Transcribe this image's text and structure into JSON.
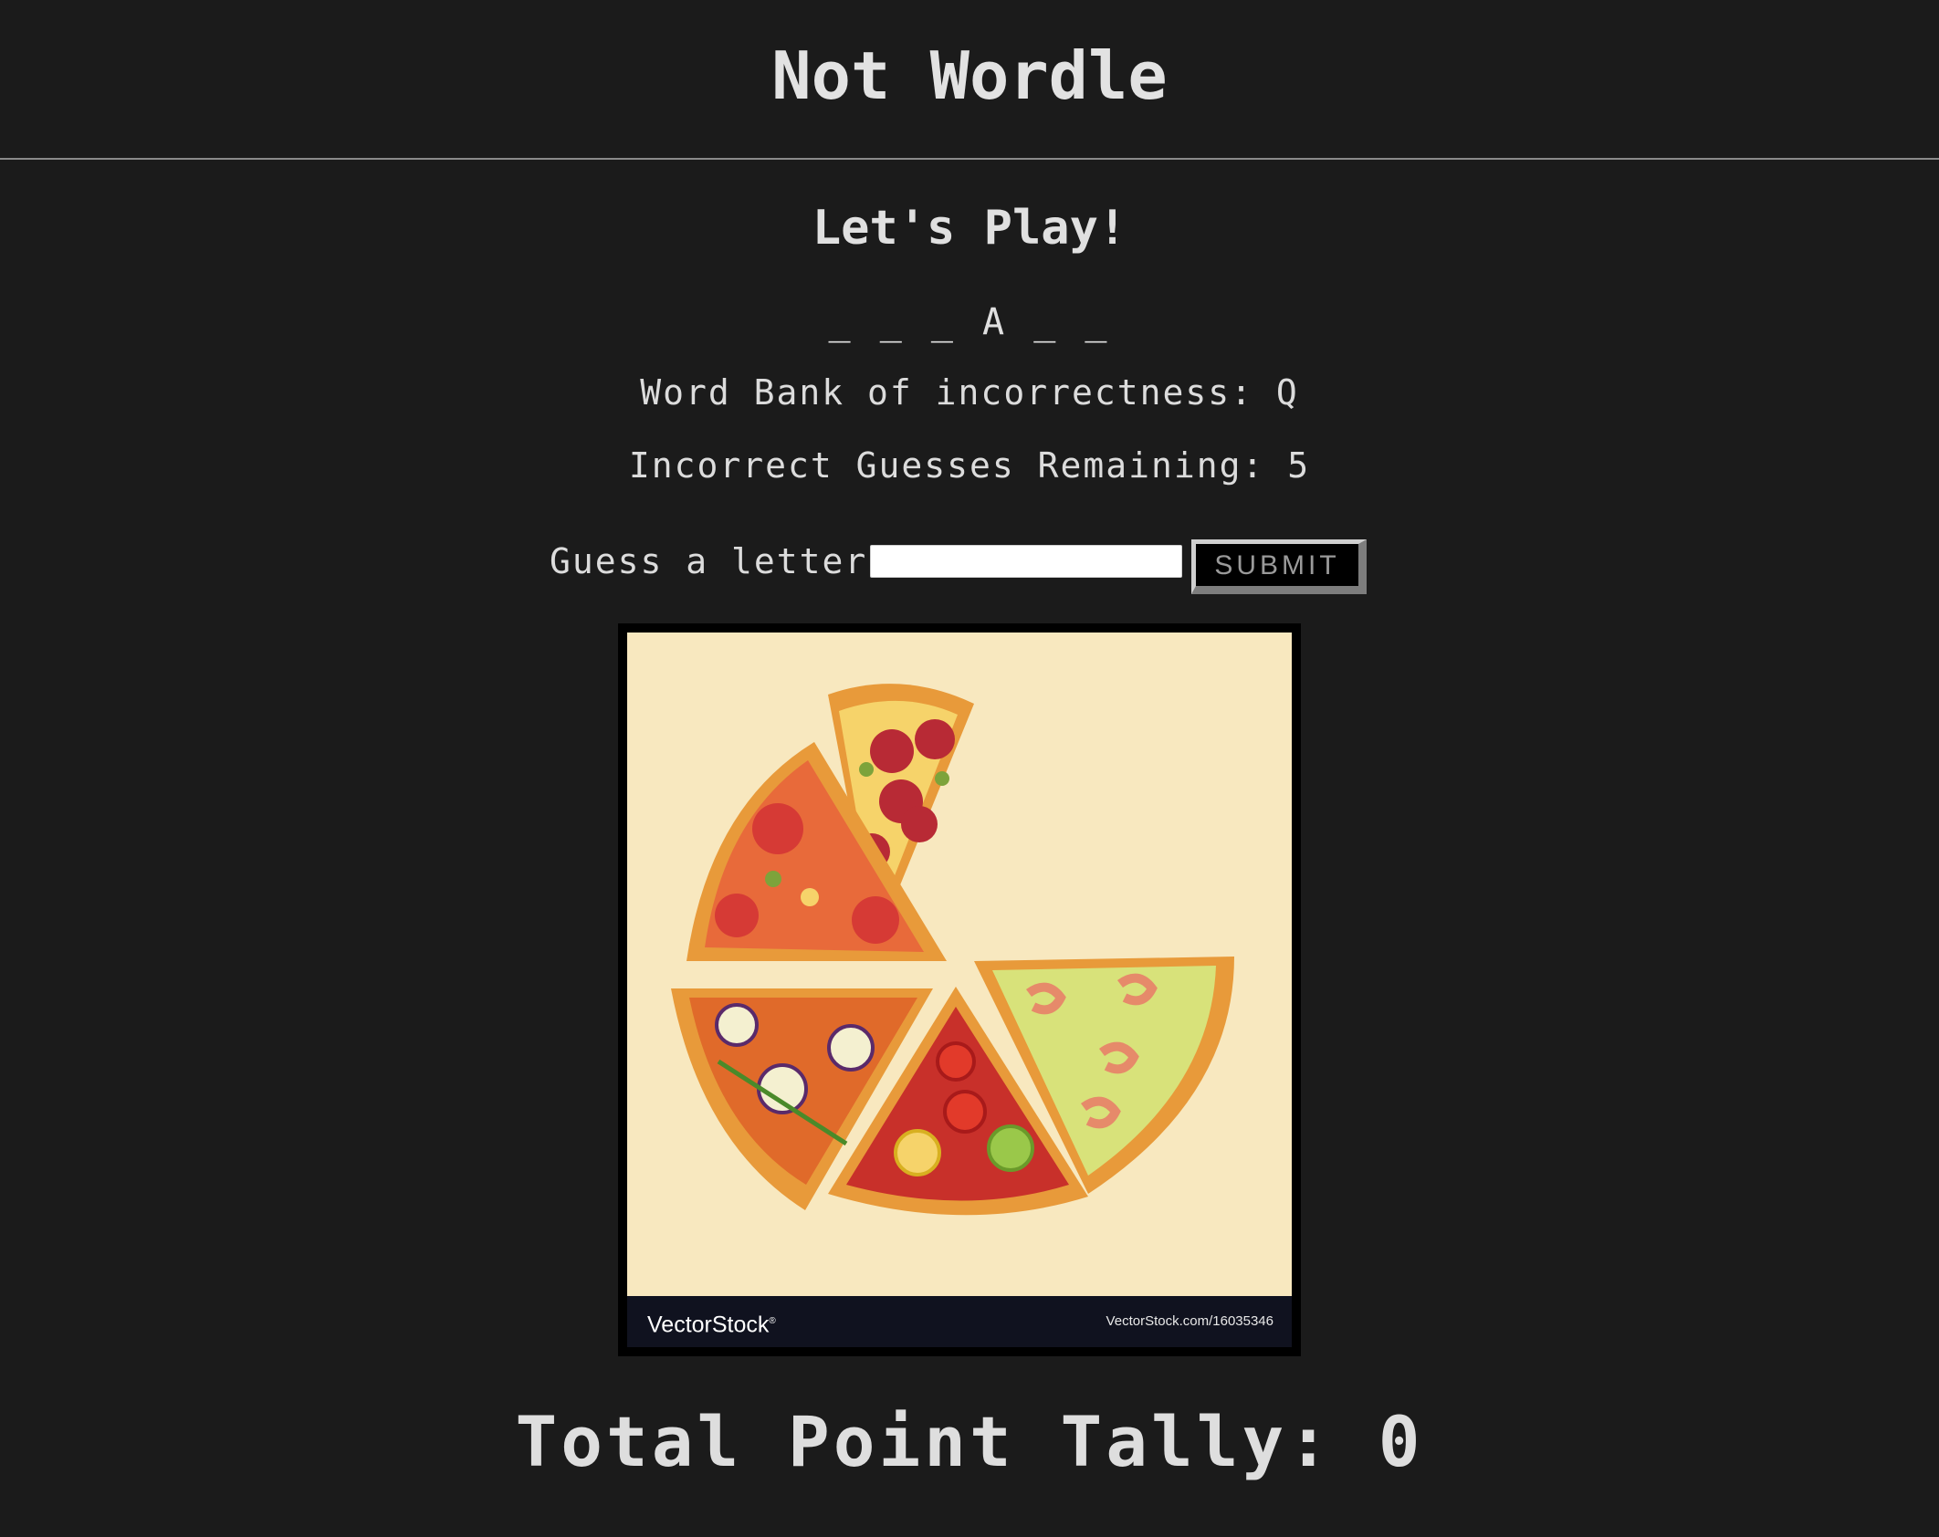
{
  "header": {
    "title": "Not Wordle"
  },
  "game": {
    "subtitle": "Let's Play!",
    "word_display": "_ _ _ A _ _",
    "word_bank": "Word Bank of incorrectness: Q",
    "remaining": "Incorrect Guesses Remaining: 5",
    "guess_label": "Guess a letter:",
    "guess_value": "",
    "guess_placeholder": "",
    "submit_label": "SUBMIT"
  },
  "image": {
    "logo_text": "VectorStock",
    "logo_mark": "®",
    "source_text": "VectorStock.com/16035346",
    "colors": {
      "background": "#f8e8bf",
      "crust": "#e89a3a",
      "sauce": "#d4452c",
      "cheese": "#f6d36a"
    }
  },
  "footer": {
    "tally": "Total Point Tally: 0"
  }
}
